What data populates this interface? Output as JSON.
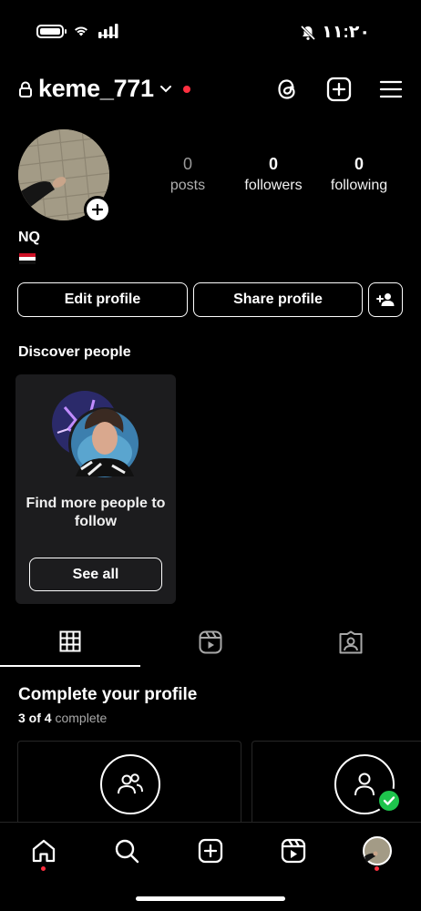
{
  "status_bar": {
    "time": "١١:٢٠",
    "icons": [
      "battery-icon",
      "wifi-icon",
      "signal-icon",
      "silent-bell-icon"
    ]
  },
  "header": {
    "username": "keme_771",
    "icons": [
      "lock-icon",
      "chevron-down-icon",
      "threads-icon",
      "create-post-icon",
      "menu-icon"
    ]
  },
  "profile": {
    "name": "NQ",
    "flag": "egypt-flag-icon",
    "stats": [
      {
        "value": "0",
        "label": "posts"
      },
      {
        "value": "0",
        "label": "followers"
      },
      {
        "value": "0",
        "label": "following"
      }
    ]
  },
  "actions": {
    "edit_profile": "Edit profile",
    "share_profile": "Share profile"
  },
  "discover": {
    "title": "Discover people",
    "card_text": "Find more people to follow",
    "see_all": "See all"
  },
  "tabs": [
    "grid-icon",
    "reels-icon",
    "tagged-icon"
  ],
  "complete_profile": {
    "title": "Complete your profile",
    "progress_count": "3 of 4",
    "progress_word": "complete"
  },
  "bottom_nav": [
    "home-icon",
    "search-icon",
    "create-icon",
    "reels-icon",
    "profile-avatar"
  ],
  "colors": {
    "background": "#000000",
    "notification": "#ff3040",
    "success": "#1ec34c",
    "card": "#1c1c1e"
  }
}
